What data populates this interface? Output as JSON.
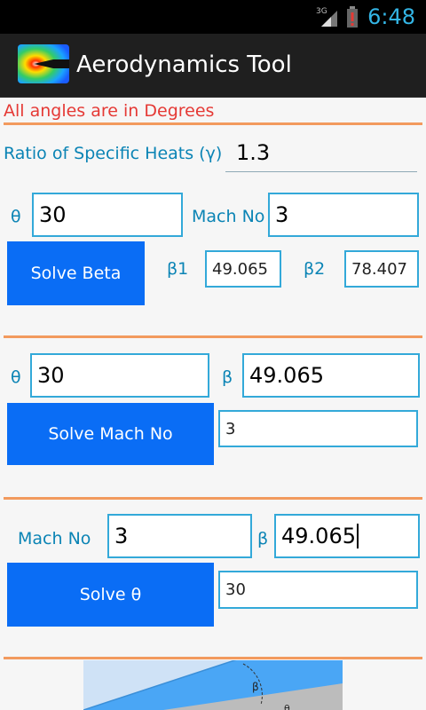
{
  "status_bar": {
    "network": "3G",
    "time": "6:48"
  },
  "app": {
    "title": "Aerodynamics Tool"
  },
  "note": "All angles are in Degrees",
  "gamma": {
    "label": "Ratio of Specific Heats (γ)",
    "value": "1.3"
  },
  "section1": {
    "theta_label": "θ",
    "theta_value": "30",
    "mach_label": "Mach No",
    "mach_value": "3",
    "button": "Solve Beta",
    "beta1_label": "β1",
    "beta1_value": "49.065",
    "beta2_label": "β2",
    "beta2_value": "78.407"
  },
  "section2": {
    "theta_label": "θ",
    "theta_value": "30",
    "beta_label": "β",
    "beta_value": "49.065",
    "button": "Solve Mach No",
    "result_value": "3"
  },
  "section3": {
    "mach_label": "Mach No",
    "mach_value": "3",
    "beta_label": "β",
    "beta_value": "49.065",
    "button": "Solve θ",
    "result_value": "30"
  },
  "diagram": {
    "beta_label": "β",
    "theta_label": "θ"
  },
  "colors": {
    "accent_button": "#0a6df5",
    "divider": "#f29a5e",
    "label": "#0b84b5",
    "warning": "#e53935",
    "field_border": "#33a9d9"
  }
}
